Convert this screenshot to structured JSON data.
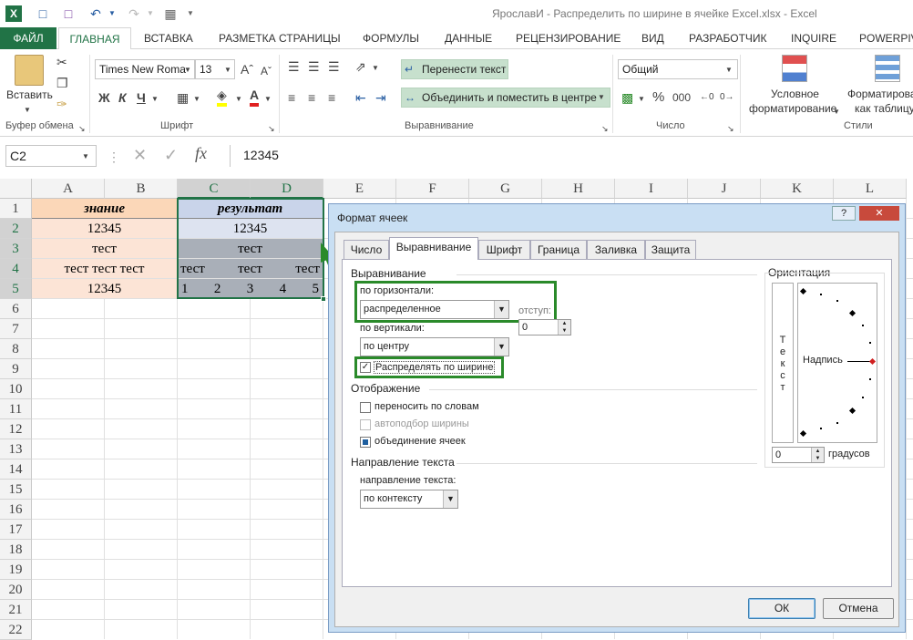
{
  "window": {
    "title": "ЯрославИ - Распределить по ширине в ячейке Excel.xlsx - Excel"
  },
  "tabs": [
    "ФАЙЛ",
    "ГЛАВНАЯ",
    "ВСТАВКА",
    "РАЗМЕТКА СТРАНИЦЫ",
    "ФОРМУЛЫ",
    "ДАННЫЕ",
    "РЕЦЕНЗИРОВАНИЕ",
    "ВИД",
    "РАЗРАБОТЧИК",
    "INQUIRE",
    "POWERPIVOT"
  ],
  "ribbon": {
    "paste_label": "Вставить",
    "clipboard_group": "Буфер обмена",
    "font_name": "Times New Roma",
    "font_size": "13",
    "bold": "Ж",
    "italic": "К",
    "underline": "Ч",
    "font_group": "Шрифт",
    "wrap_text": "Перенести текст",
    "merge_center": "Объединить и поместить в центре",
    "alignment_group": "Выравнивание",
    "number_format": "Общий",
    "percent": "%",
    "thousands": "000",
    "number_group": "Число",
    "cond_format_l1": "Условное",
    "cond_format_l2": "форматирование",
    "format_table_l1": "Форматирова",
    "format_table_l2": "как таблицу",
    "styles_group": "Стили"
  },
  "formula_bar": {
    "name_box": "C2",
    "fx": "fx",
    "value": "12345"
  },
  "sheet": {
    "columns": [
      "A",
      "B",
      "C",
      "D",
      "E",
      "F",
      "G",
      "H",
      "I",
      "J",
      "K",
      "L"
    ],
    "rows": [
      "1",
      "2",
      "3",
      "4",
      "5",
      "6",
      "7",
      "8",
      "9",
      "10",
      "11",
      "12",
      "13",
      "14",
      "15",
      "16",
      "17",
      "18",
      "19",
      "20",
      "21",
      "22"
    ],
    "header_left": "знание",
    "header_right": "результат",
    "left_values": [
      "12345",
      "тест",
      "тест тест тест",
      "12345"
    ],
    "right_merged": [
      "12345",
      "тест"
    ],
    "row4_right": [
      "тест",
      "тест",
      "тест"
    ],
    "row5_right": [
      "1",
      "2",
      "3",
      "4",
      "5"
    ]
  },
  "dialog": {
    "title": "Формат ячеек",
    "help": "?",
    "close": "✕",
    "tabs": [
      "Число",
      "Выравнивание",
      "Шрифт",
      "Граница",
      "Заливка",
      "Защита"
    ],
    "align_section": "Выравнивание",
    "horizontal_label": "по горизонтали:",
    "horizontal_value": "распределенное",
    "indent_label": "отступ:",
    "indent_value": "0",
    "vertical_label": "по вертикали:",
    "vertical_value": "по центру",
    "justify_distributed": "Распределять по ширине",
    "display_section": "Отображение",
    "wrap_words": "переносить по словам",
    "shrink_fit": "автоподбор ширины",
    "merge_cells": "объединение ячеек",
    "direction_section": "Направление текста",
    "direction_label": "направление текста:",
    "direction_value": "по контексту",
    "orientation_section": "Ориентация",
    "vertical_text": [
      "Т",
      "е",
      "к",
      "с",
      "т"
    ],
    "inscription": "Надпись",
    "degrees_value": "0",
    "degrees_label": "градусов",
    "ok": "ОК",
    "cancel": "Отмена"
  }
}
